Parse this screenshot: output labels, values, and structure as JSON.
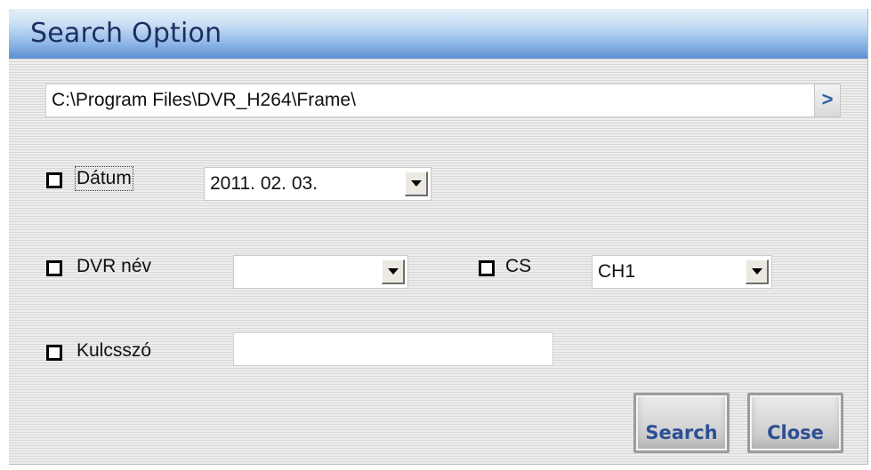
{
  "window": {
    "title": "Search Option"
  },
  "path": {
    "value": "C:\\Program Files\\DVR_H264\\Frame\\",
    "browse_label": ">"
  },
  "date": {
    "label": "Dátum",
    "value": "2011. 02. 03.",
    "checked": false
  },
  "dvr": {
    "label": "DVR név",
    "value": "",
    "checked": false
  },
  "channel": {
    "label": "CS",
    "value": "CH1",
    "checked": false
  },
  "keyword": {
    "label": "Kulcsszó",
    "value": "",
    "checked": false
  },
  "buttons": {
    "search_label": "Search",
    "close_label": "Close"
  },
  "colors": {
    "title_bar": "#8db6e6",
    "title_text": "#1d2f62",
    "button_text": "#2c4f94",
    "background_stripe": "#d6d6d6"
  }
}
